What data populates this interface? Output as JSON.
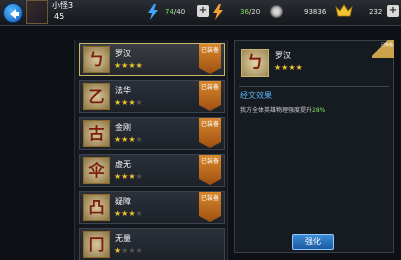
{
  "header": {
    "player_name": "小怪3",
    "player_level": "45",
    "energy": {
      "current": "74",
      "max": "/40"
    },
    "stamina": {
      "current": "36",
      "max": "/20"
    },
    "coins": "93836",
    "gold": "232",
    "plus": "+"
  },
  "list": {
    "items": [
      {
        "name": "罗汉",
        "stars": "★★★★",
        "stars_off": "",
        "equipped": "已装备",
        "glyph": "ㄅ"
      },
      {
        "name": "法华",
        "stars": "★★★",
        "stars_off": "★",
        "equipped": "已装备",
        "glyph": "乙"
      },
      {
        "name": "金刚",
        "stars": "★★★",
        "stars_off": "★",
        "equipped": "已装备",
        "glyph": "古"
      },
      {
        "name": "虚无",
        "stars": "★★★",
        "stars_off": "★",
        "equipped": "已装备",
        "glyph": "伞"
      },
      {
        "name": "疑障",
        "stars": "★★★",
        "stars_off": "★",
        "equipped": "已装备",
        "glyph": "凸"
      },
      {
        "name": "无量",
        "stars": "★",
        "stars_off": "★★★",
        "equipped": "",
        "glyph": "冂"
      }
    ]
  },
  "detail": {
    "name": "罗汉",
    "stars": "★★★★",
    "glyph": "ㄅ",
    "badge": "已装备",
    "section_title": "经文效果",
    "effect_prefix": "我方全体英雄物理强度提升",
    "effect_value": "28%",
    "enhance_label": "强化"
  },
  "colors": {
    "accent_blue": "#5ab4f0",
    "value_green": "#7ee35b",
    "star_gold": "#f2c230",
    "equipped_orange": "#d9892b"
  }
}
